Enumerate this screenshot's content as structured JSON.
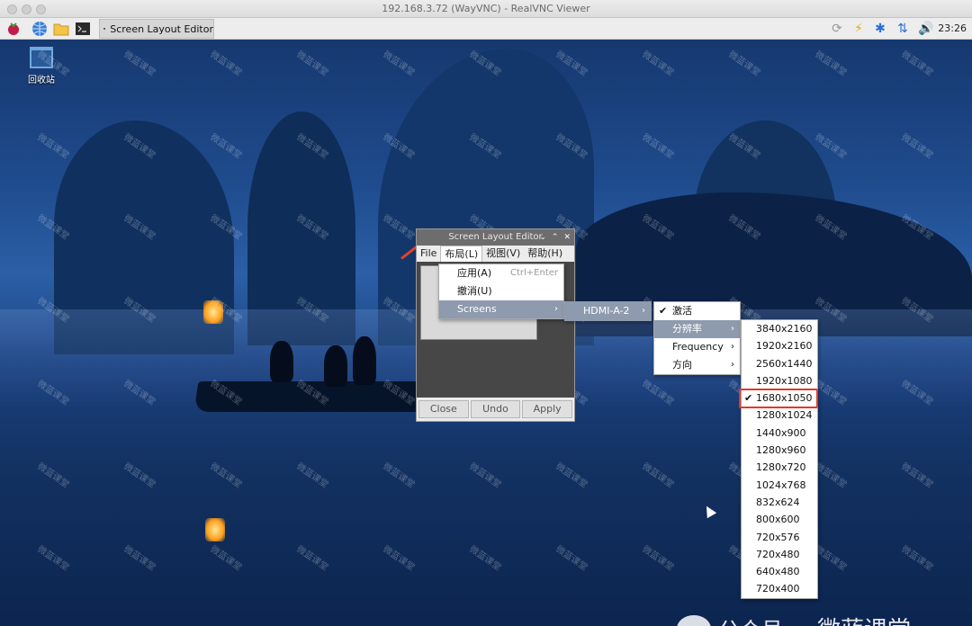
{
  "mac": {
    "title": "192.168.3.72 (WayVNC) - RealVNC Viewer"
  },
  "taskbar": {
    "window_label": "Screen Layout Editor",
    "clock": "23:26"
  },
  "desktop": {
    "trash_label": "回收站",
    "watermark": "微蓝课堂",
    "footer_prefix": "公众号",
    "footer_brand": "微蓝课堂"
  },
  "editor": {
    "title": "Screen Layout Editor",
    "menus": [
      "File",
      "布局(L)",
      "视图(V)",
      "帮助(H)"
    ],
    "buttons": [
      "Close",
      "Undo",
      "Apply"
    ]
  },
  "layout_menu": {
    "items": [
      {
        "label": "应用(A)",
        "accel": "Ctrl+Enter"
      },
      {
        "label": "撤消(U)",
        "accel": ""
      },
      {
        "label": "Screens",
        "accel": ""
      }
    ]
  },
  "screens_menu": {
    "items": [
      "HDMI-A-2"
    ]
  },
  "hdmi_menu": {
    "items": [
      "激活",
      "分辨率",
      "Frequency",
      "方向"
    ]
  },
  "resolution_menu": {
    "selected": "1680x1050",
    "items": [
      "3840x2160",
      "1920x2160",
      "2560x1440",
      "1920x1080",
      "1680x1050",
      "1280x1024",
      "1440x900",
      "1280x960",
      "1280x720",
      "1024x768",
      "832x624",
      "800x600",
      "720x576",
      "720x480",
      "640x480",
      "720x400"
    ]
  },
  "colors": {
    "highlight": "#8e9aae",
    "annotation": "#e23a2a"
  }
}
